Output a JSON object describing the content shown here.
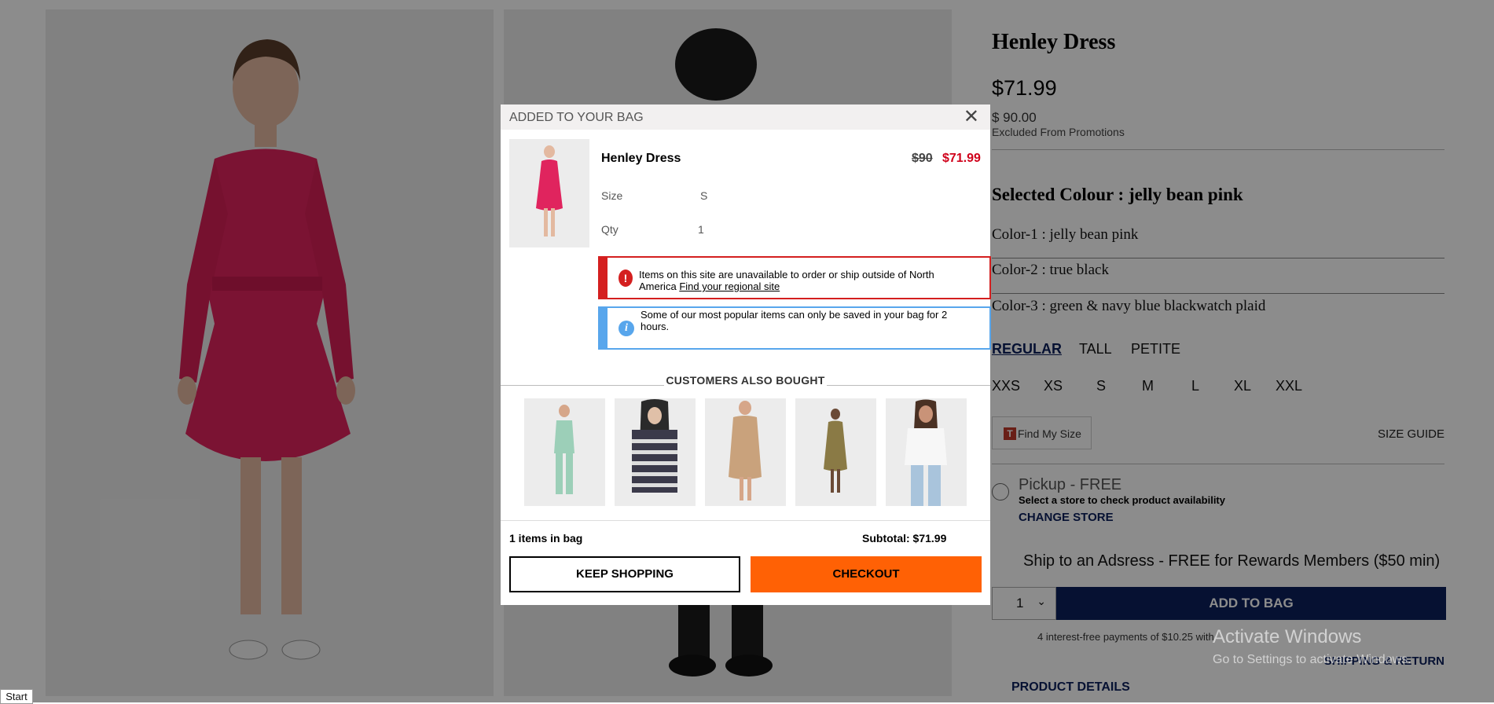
{
  "product": {
    "title": "Henley Dress",
    "price": "$71.99",
    "original_price": "$ 90.00",
    "promo_note": "Excluded From Promotions",
    "selected_colour": "Selected Colour : jelly bean pink",
    "colors": [
      "Color-1 : jelly bean pink",
      "Color-2 : true black",
      "Color-3 : green & navy blue blackwatch plaid"
    ],
    "fits": [
      "REGULAR",
      "TALL",
      "PETITE"
    ],
    "sizes": [
      "XXS",
      "XS",
      "S",
      "M",
      "L",
      "XL",
      "XXL"
    ],
    "find_my_size": "Find My Size",
    "find_my_size_badge": "T",
    "size_guide": "SIZE GUIDE",
    "pickup": "Pickup - FREE",
    "pickup_sub": "Select a store to check product availability",
    "change_store": "CHANGE STORE",
    "ship": "Ship to an Adsress - FREE for Rewards Members ($50 min)",
    "qty": "1",
    "add_to_bag": "ADD TO BAG",
    "installments": "4 interest-free payments of $10.25 with",
    "shipping_return": "SHIPPING & RETURN",
    "product_details": "PRODUCT DETAILS"
  },
  "modal": {
    "title": "ADDED TO YOUR BAG",
    "close": "✕",
    "item_name": "Henley Dress",
    "price_was": "$90",
    "price_now": "$71.99",
    "size_label": "Size",
    "size_value": "S",
    "qty_label": "Qty",
    "qty_value": "1",
    "alert_error_icon": "!",
    "alert_error_text": "Items on this site are unavailable to order or ship outside of North America",
    "alert_error_link": "Find your regional site",
    "alert_info_icon": "i",
    "alert_info_text": "Some of our most popular items can only be saved in your bag for 2 hours.",
    "also_bought_title": "CUSTOMERS ALSO BOUGHT",
    "items_in_bag": "1 items in bag",
    "subtotal": "Subtotal: $71.99",
    "keep_shopping": "KEEP SHOPPING",
    "checkout": "CHECKOUT"
  },
  "system": {
    "start": "Start",
    "activate_title": "Activate Windows",
    "activate_sub": "Go to Settings to activate Windows."
  },
  "colors": {
    "navy": "#0b1f5c",
    "checkout_orange": "#ff6105",
    "sale_red": "#d0021b",
    "dress_pink": "#e0245e"
  }
}
